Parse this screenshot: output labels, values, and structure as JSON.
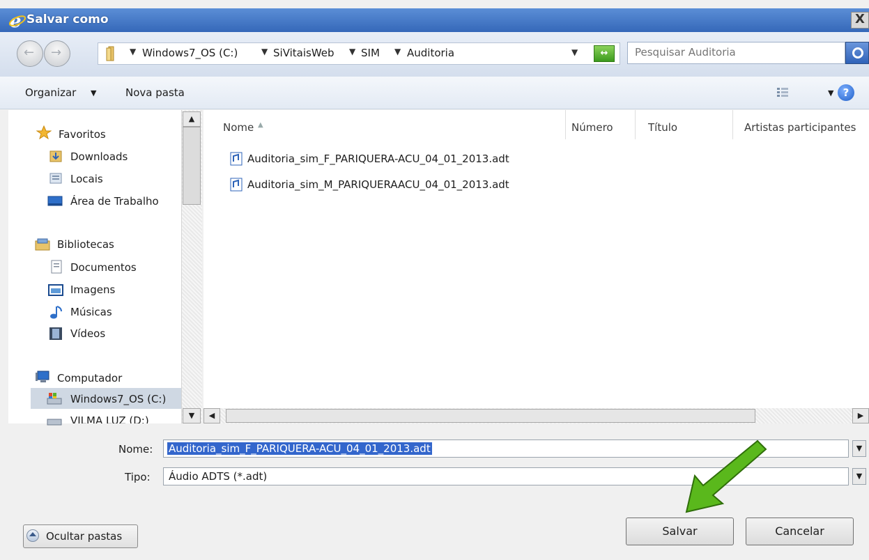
{
  "window": {
    "title": "Salvar como",
    "close_label": "X"
  },
  "navigation": {
    "breadcrumbs": [
      "Windows7_OS (C:)",
      "SiVitaisWeb",
      "SIM",
      "Auditoria"
    ],
    "search_placeholder": "Pesquisar Auditoria"
  },
  "toolbar": {
    "organize_label": "Organizar",
    "new_folder_label": "Nova pasta",
    "help_label": "?"
  },
  "nav_pane": {
    "favorites": {
      "label": "Favoritos",
      "items": [
        "Downloads",
        "Locais",
        "Área de Trabalho"
      ]
    },
    "libraries": {
      "label": "Bibliotecas",
      "items": [
        "Documentos",
        "Imagens",
        "Músicas",
        "Vídeos"
      ]
    },
    "computer": {
      "label": "Computador",
      "items": [
        "Windows7_OS (C:)",
        "VILMA LUZ (D:)"
      ]
    }
  },
  "file_list": {
    "columns": [
      "Nome",
      "Número",
      "Título",
      "Artistas participantes"
    ],
    "files": [
      "Auditoria_sim_F_PARIQUERA-ACU_04_01_2013.adt",
      "Auditoria_sim_M_PARIQUERAACU_04_01_2013.adt"
    ]
  },
  "form": {
    "name_label": "Nome:",
    "name_value": "Auditoria_sim_F_PARIQUERA-ACU_04_01_2013.adt",
    "type_label": "Tipo:",
    "type_value": "Áudio ADTS (*.adt)"
  },
  "buttons": {
    "hide_folders": "Ocultar pastas",
    "save": "Salvar",
    "cancel": "Cancelar"
  },
  "colors": {
    "title_bar": "#3568b9",
    "selection": "#3366cc",
    "arrow": "#5ab81c"
  }
}
